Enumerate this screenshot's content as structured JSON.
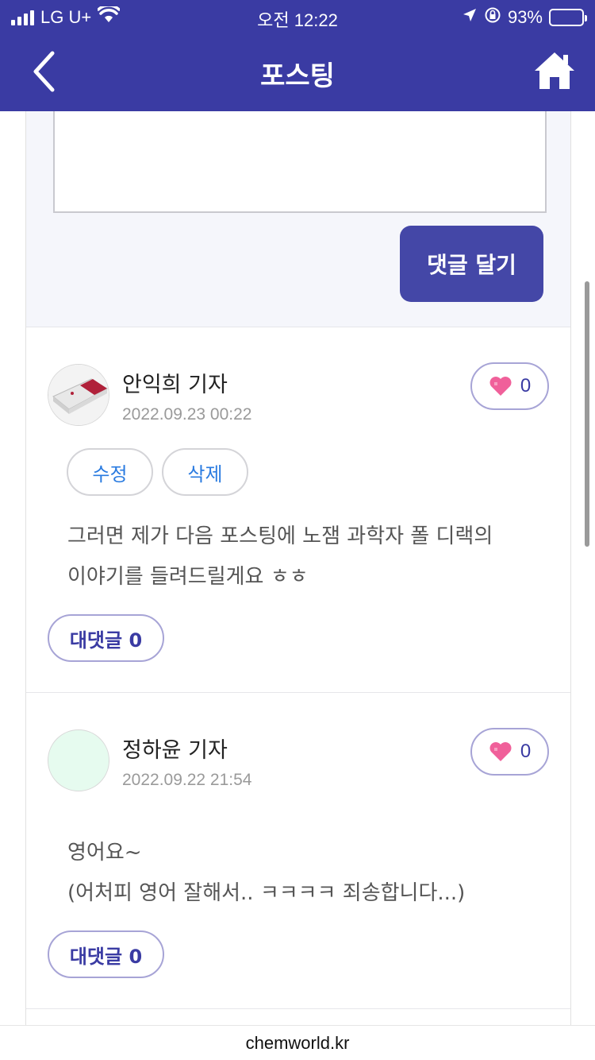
{
  "status_bar": {
    "carrier": "LG U+",
    "time": "오전 12:22",
    "battery": "93%",
    "battery_level": 0.93
  },
  "header": {
    "title": "포스팅"
  },
  "comment_form": {
    "submit_label": "댓글 달기"
  },
  "comments": [
    {
      "author": "안익희 기자",
      "date": "2022.09.23 00:22",
      "likes": "0",
      "edit_label": "수정",
      "delete_label": "삭제",
      "text_line1": "그러면 제가 다음 포스팅에 노잼 과학자 폴 디랙의",
      "text_line2": "이야기를 들려드릴게요 ㅎㅎ",
      "reply_label": "대댓글 0"
    },
    {
      "author": "정하윤 기자",
      "date": "2022.09.22 21:54",
      "likes": "0",
      "text_line1": "영어요~",
      "text_line2": "(어처피 영어 잘해서.. ㅋㅋㅋㅋ 죄송합니다...)",
      "reply_label": "대댓글 0"
    }
  ],
  "footer": {
    "url": "chemworld.kr"
  },
  "colors": {
    "brand": "#3a3ba3",
    "button": "#4447a7",
    "heart": "#f0609a",
    "link_blue": "#2a7be0",
    "avatar2_bg": "#e6fbef"
  },
  "icons": {
    "back": "chevron-left-icon",
    "home": "home-icon",
    "like": "heart-icon",
    "wifi": "wifi-icon",
    "location": "location-arrow-icon",
    "lock": "orientation-lock-icon"
  }
}
